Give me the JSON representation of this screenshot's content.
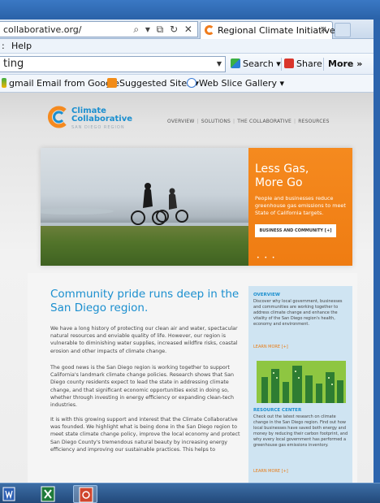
{
  "browser": {
    "address": {
      "url": "collaborative.org/",
      "controls": "⌕ ▾ ⧉ ↻ ✕"
    },
    "tab": {
      "title": "Regional Climate Initiative ...",
      "close": "✕"
    },
    "menu": {
      "items": [
        ":",
        "Help"
      ]
    },
    "search": {
      "value": "ting"
    },
    "command_bar": {
      "search_label": "Search",
      "share_label": "Share",
      "more_label": "More »"
    },
    "favorites": {
      "items": [
        "gmail Email from Google",
        "Suggested Sites ▾",
        "Web Slice Gallery ▾"
      ]
    }
  },
  "page": {
    "logo": {
      "line1": "Climate",
      "line2": "Collaborative",
      "line3": "SAN DIEGO REGION"
    },
    "nav": [
      "OVERVIEW",
      "SOLUTIONS",
      "THE COLLABORATIVE",
      "RESOURCES"
    ],
    "hero": {
      "title_line1": "Less Gas,",
      "title_line2": "More Go",
      "text": "People and businesses reduce greenhouse gas emissions to meet State of California targets.",
      "button": "BUSINESS AND COMMUNITY [+]",
      "dots": "• • •"
    },
    "main": {
      "headline": "Community pride runs deep in the San Diego region.",
      "para1": "We have a long history of protecting our clean air and water, spectacular natural resources and enviable quality of life. However, our region is vulnerable to diminishing water supplies, increased wildfire risks, coastal erosion and other impacts of climate change.",
      "para2": "The good news is the San Diego region is working together to support California's landmark climate change policies. Research shows that San Diego county residents expect to lead the state in addressing climate change, and that significant economic opportunities exist in doing so, whether through investing in energy efficiency or expanding clean-tech industries.",
      "para3": "It is with this growing support and interest that the Climate Collaborative was founded. We highlight what is being done in the San Diego region to meet state climate change policy, improve the local economy and protect San Diego County's tremendous natural beauty by increasing energy efficiency and improving our sustainable practices. This helps to"
    },
    "sidebar": {
      "overview_title": "OVERVIEW",
      "overview_text": "Discover why local government, businesses and communities are working together to address climate change and enhance the vitality of the San Diego region's health, economy and environment.",
      "overview_link": "LEARN MORE [+]",
      "resource_title": "RESOURCE CENTER",
      "resource_text": "Check out the latest research on climate change in the San Diego region. Find out how local businesses have saved both energy and money by reducing their carbon footprint, and why every local government has performed a greenhouse gas emissions inventory.",
      "resource_link": "LEARN MORE [+]"
    }
  },
  "colors": {
    "brand_blue": "#1b8fcf",
    "hero_orange": "#f58a1f",
    "sidebar_bg": "#cfe4f2"
  }
}
